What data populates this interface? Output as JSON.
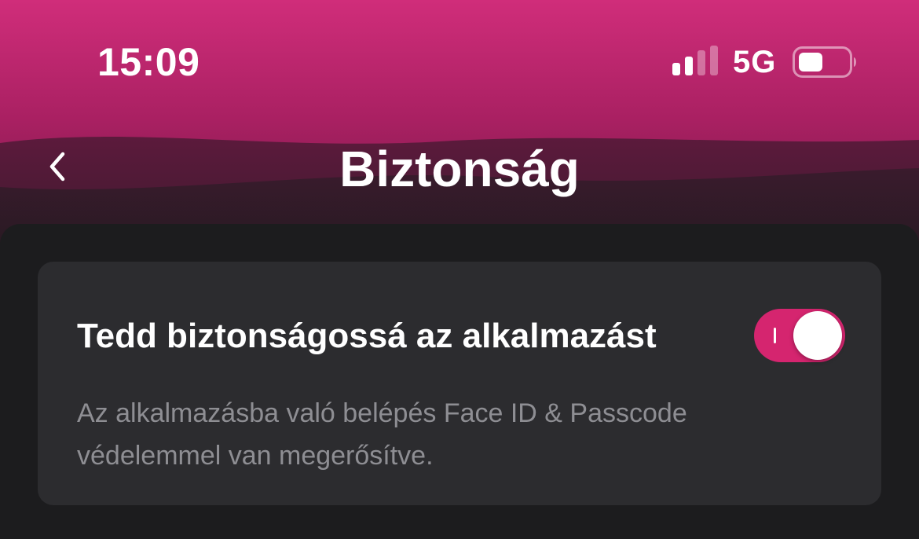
{
  "status_bar": {
    "time": "15:09",
    "network": "5G",
    "signal_bars_active": 2,
    "signal_bars_total": 4,
    "battery_level": 0.4
  },
  "nav": {
    "back_icon": "chevron-left-icon",
    "title": "Biztonság"
  },
  "security_setting": {
    "title": "Tedd biztonságossá az alkalmazást",
    "description": "Az alkalmazásba való belépés Face ID & Passcode védelemmel van megerősítve.",
    "toggle_on": true
  },
  "colors": {
    "header_top": "#d02d7a",
    "header_bottom": "#2a1a24",
    "accent": "#d5256f",
    "background": "#1c1c1e",
    "card": "#2c2c2f",
    "secondary_text": "#8e8e93"
  }
}
